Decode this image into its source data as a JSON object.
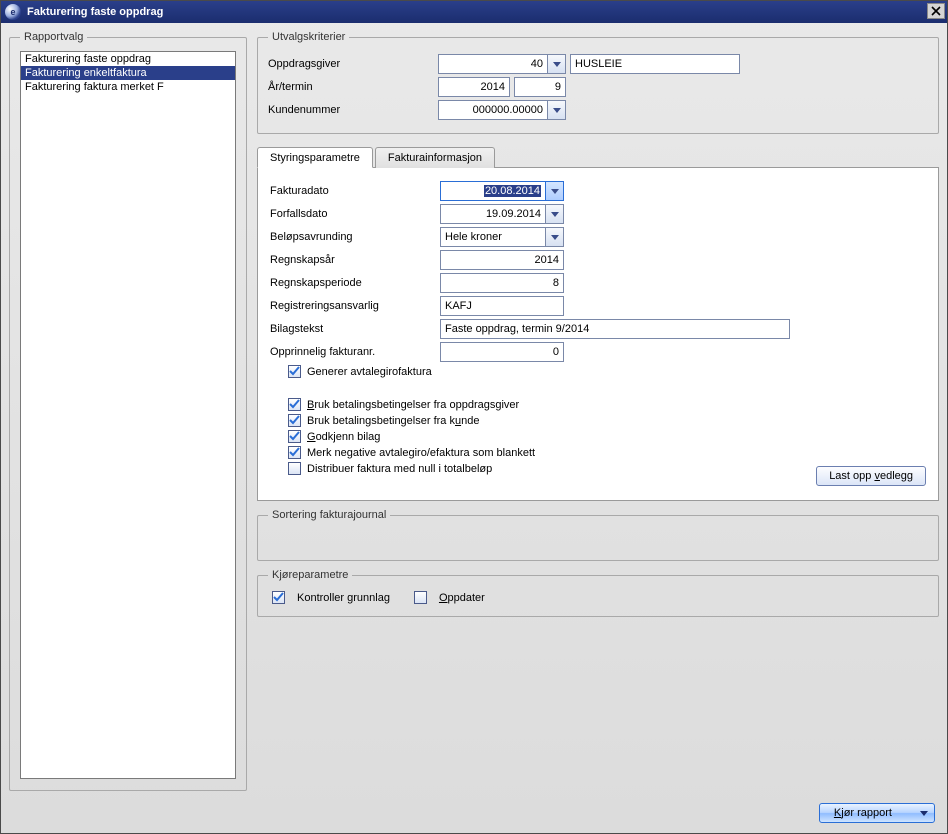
{
  "window": {
    "title": "Fakturering faste oppdrag"
  },
  "left": {
    "legend": "Rapportvalg",
    "items": [
      {
        "label": "Fakturering faste oppdrag",
        "selected": false
      },
      {
        "label": "Fakturering enkeltfaktura",
        "selected": true
      },
      {
        "label": "Fakturering faktura merket F",
        "selected": false
      }
    ]
  },
  "criteria": {
    "legend": "Utvalgskriterier",
    "oppdragsgiver_label": "Oppdragsgiver",
    "oppdragsgiver_value": "40",
    "oppdragsgiver_name": "HUSLEIE",
    "aar_termin_label": "År/termin",
    "aar_value": "2014",
    "termin_value": "9",
    "kundenummer_label": "Kundenummer",
    "kundenummer_value": "000000.00000"
  },
  "tabs": {
    "tab1": "Styringsparametre",
    "tab2": "Fakturainformasjon"
  },
  "params": {
    "fakturadato_label": "Fakturadato",
    "fakturadato_value": "20.08.2014",
    "forfallsdato_label": "Forfallsdato",
    "forfallsdato_value": "19.09.2014",
    "belopsavrunding_label": "Beløpsavrunding",
    "belopsavrunding_value": "Hele kroner",
    "regnskapsaar_label": "Regnskapsår",
    "regnskapsaar_value": "2014",
    "regnskapsperiode_label": "Regnskapsperiode",
    "regnskapsperiode_value": "8",
    "registreringsansvarlig_label": "Registreringsansvarlig",
    "registreringsansvarlig_value": "KAFJ",
    "bilagstekst_label": "Bilagstekst",
    "bilagstekst_value": "Faste oppdrag, termin 9/2014",
    "opprinnelig_label": "Opprinnelig fakturanr.",
    "opprinnelig_value": "0",
    "chk_generer": {
      "label": "Generer avtalegirofaktura",
      "checked": true
    },
    "chk_bb_oppdragsgiver": {
      "pre": "",
      "u": "B",
      "post": "ruk betalingsbetingelser fra oppdragsgiver",
      "checked": true
    },
    "chk_bb_kunde": {
      "pre": "Bruk betalingsbetingelser fra k",
      "u": "u",
      "post": "nde",
      "checked": true
    },
    "chk_godkjenn": {
      "pre": "",
      "u": "G",
      "post": "odkjenn bilag",
      "checked": true
    },
    "chk_merk_neg": {
      "label": "Merk negative avtalegiro/efaktura som blankett",
      "checked": true
    },
    "chk_distribuer": {
      "label": "Distribuer faktura med null i totalbeløp",
      "checked": false
    },
    "upload_btn_pre": "Last opp ",
    "upload_btn_u": "v",
    "upload_btn_post": "edlegg"
  },
  "sort": {
    "legend": "Sortering fakturajournal"
  },
  "run": {
    "legend": "Kjøreparametre",
    "chk_kontroller": {
      "label": "Kontroller grunnlag",
      "checked": true
    },
    "chk_oppdater": {
      "pre": "",
      "u": "O",
      "post": "ppdater",
      "checked": false
    }
  },
  "footer": {
    "run_pre": "",
    "run_u": "K",
    "run_post": "jør rapport"
  }
}
